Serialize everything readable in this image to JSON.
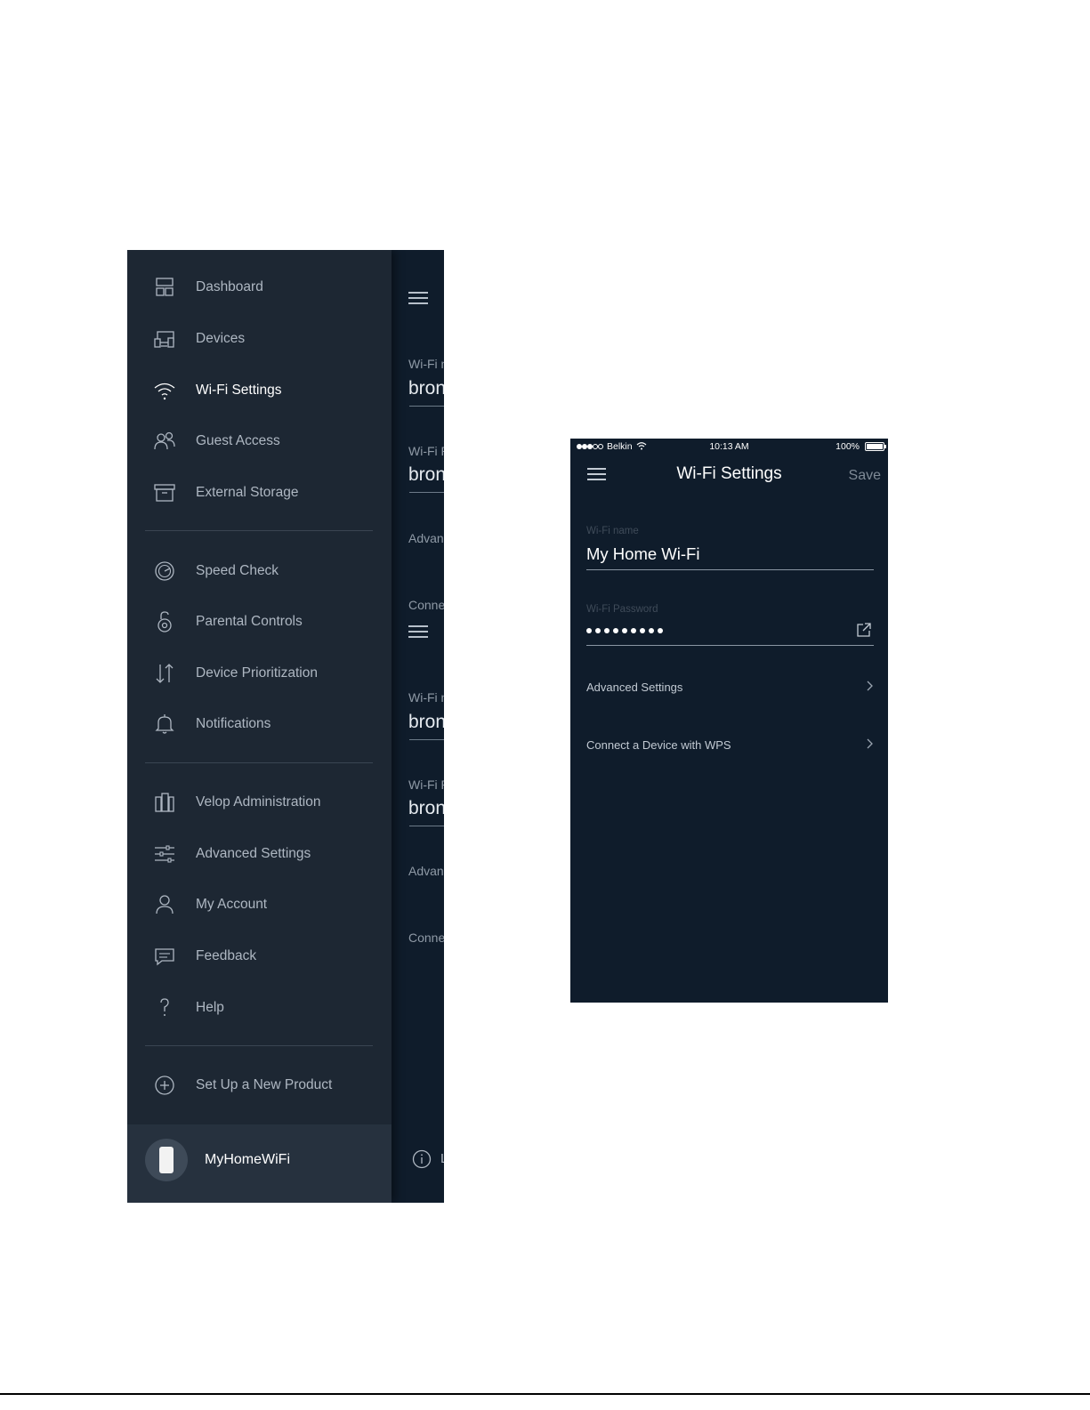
{
  "left_phone": {
    "background_screen": {
      "sections": [
        {
          "field1_label": "Wi-Fi n",
          "field1_value": "bron",
          "field2_label": "Wi-Fi P",
          "field2_value": "bron",
          "row1": "Advan",
          "row2": "Conne"
        },
        {
          "field1_label": "Wi-Fi n",
          "field1_value": "bron",
          "field2_label": "Wi-Fi P",
          "field2_value": "bron",
          "row1": "Advan",
          "row2": "Conne"
        }
      ],
      "info_text": "L"
    },
    "menu": {
      "group1": [
        {
          "label": "Dashboard",
          "icon": "dashboard-icon"
        },
        {
          "label": "Devices",
          "icon": "devices-icon"
        },
        {
          "label": "Wi-Fi Settings",
          "icon": "wifi-icon",
          "active": true
        },
        {
          "label": "Guest Access",
          "icon": "guest-icon"
        },
        {
          "label": "External Storage",
          "icon": "storage-icon"
        }
      ],
      "group2": [
        {
          "label": "Speed Check",
          "icon": "speedometer-icon"
        },
        {
          "label": "Parental Controls",
          "icon": "lock-icon"
        },
        {
          "label": "Device Prioritization",
          "icon": "priority-arrows-icon"
        },
        {
          "label": "Notifications",
          "icon": "bell-icon"
        }
      ],
      "group3": [
        {
          "label": "Velop Administration",
          "icon": "velop-nodes-icon"
        },
        {
          "label": "Advanced Settings",
          "icon": "sliders-icon"
        },
        {
          "label": "My Account",
          "icon": "person-icon"
        },
        {
          "label": "Feedback",
          "icon": "chat-bubble-icon"
        },
        {
          "label": "Help",
          "icon": "question-icon"
        }
      ],
      "group4": [
        {
          "label": "Set Up a New Product",
          "icon": "plus-circle-icon"
        }
      ]
    },
    "account": {
      "name": "MyHomeWiFi",
      "avatar_icon": "velop-node-icon"
    }
  },
  "right_phone": {
    "status_bar": {
      "carrier": "Belkin",
      "time": "10:13 AM",
      "battery": "100%",
      "signal_filled": 3,
      "signal_total": 5
    },
    "nav": {
      "title": "Wi-Fi Settings",
      "save_label": "Save",
      "menu_icon": "hamburger-icon"
    },
    "fields": {
      "name_label": "Wi-Fi name",
      "name_value": "My Home Wi-Fi",
      "password_label": "Wi-Fi Password",
      "password_mask_count": 9,
      "reveal_icon": "share-external-icon"
    },
    "rows": [
      {
        "label": "Advanced Settings"
      },
      {
        "label": "Connect a Device with WPS"
      }
    ]
  },
  "colors": {
    "screen_bg": "#0f1c2b",
    "drawer_bg": "#1d2733",
    "account_bar_bg": "#26313e"
  }
}
